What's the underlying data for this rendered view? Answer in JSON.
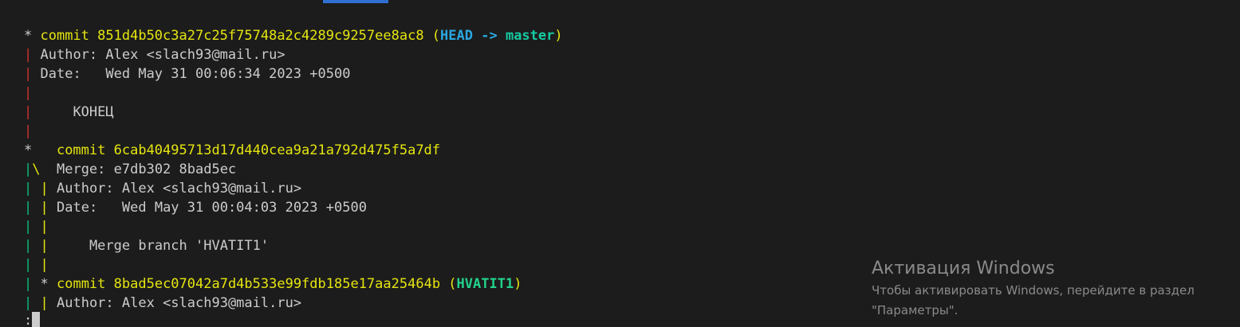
{
  "colors": {
    "background": "#1c1c1c",
    "text": "#cccccc",
    "commit_yellow": "#e5e510",
    "head_cyan": "#2aa8e0",
    "branch_green": "#16c9a0",
    "graph_red": "#cd3131",
    "graph_green": "#0dbc79",
    "watermark_gray": "#8a8a8a"
  },
  "commits": [
    {
      "graph": "* ",
      "commit_label": "commit",
      "hash": "851d4b50c3a27c25f75748a2c4289c9257ee8ac8",
      "open": " (",
      "head": "HEAD ->",
      "branch": "master",
      "close": ")",
      "author_label": "Author: ",
      "author": "Alex <slach93@mail.ru>",
      "date_label": "Date:   ",
      "date": "Wed May 31 00:06:34 2023 +0500",
      "message": "КОНЕЦ"
    },
    {
      "graph": "*   ",
      "commit_label": "commit",
      "hash": "6cab40495713d17d440cea9a21a792d475f5a7df",
      "merge_label": "Merge: ",
      "merge": "e7db302 8bad5ec",
      "author_label": "Author: ",
      "author": "Alex <slach93@mail.ru>",
      "date_label": "Date:   ",
      "date": "Wed May 31 00:04:03 2023 +0500",
      "message": "Merge branch 'HVATIT1'"
    },
    {
      "graph": "* ",
      "commit_label": "commit",
      "hash": "8bad5ec07042a7d4b533e99fdb185e17aa25464b",
      "open": " (",
      "branch": "HVATIT1",
      "close": ")",
      "author_label": "Author: ",
      "author": "Alex <slach93@mail.ru>"
    }
  ],
  "prompt": ":",
  "watermark": {
    "title": "Активация Windows",
    "line1": "Чтобы активировать Windows, перейдите в раздел",
    "line2": "\"Параметры\"."
  }
}
